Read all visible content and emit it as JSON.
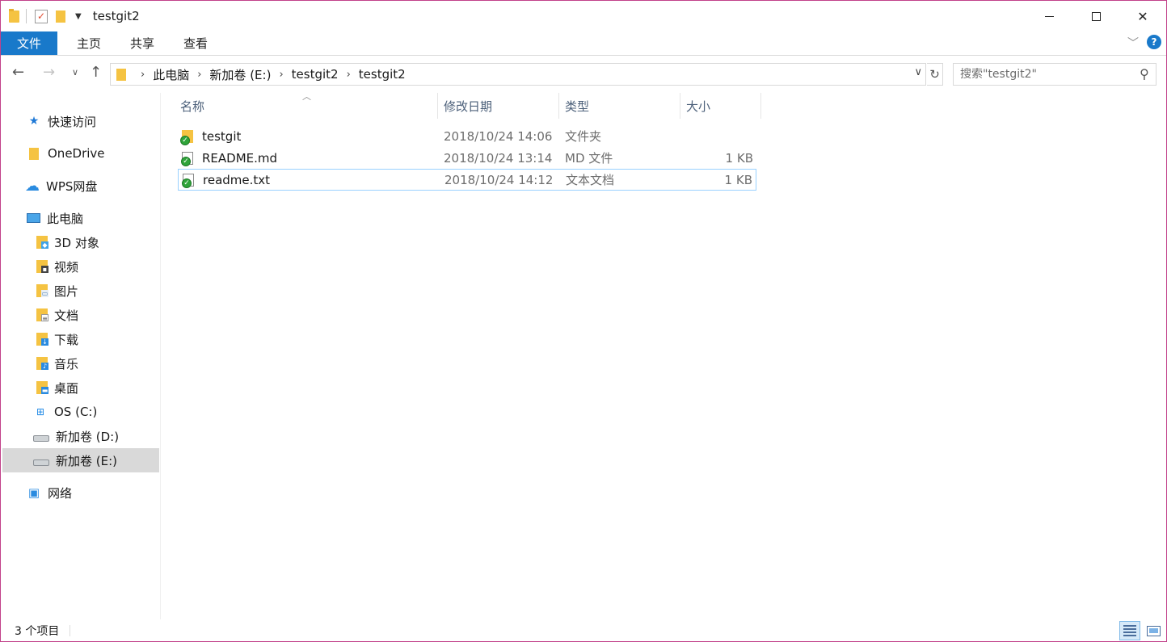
{
  "window": {
    "title": "testgit2"
  },
  "ribbon": {
    "tabs": [
      "文件",
      "主页",
      "共享",
      "查看"
    ]
  },
  "address": {
    "crumbs": [
      "此电脑",
      "新加卷 (E:)",
      "testgit2",
      "testgit2"
    ]
  },
  "search": {
    "placeholder": "搜索\"testgit2\""
  },
  "sidebar": {
    "items": [
      {
        "label": "快速访问",
        "icon": "star-icon"
      },
      {
        "label": "OneDrive",
        "icon": "folder-icon"
      },
      {
        "label": "WPS网盘",
        "icon": "cloud-icon"
      },
      {
        "label": "此电脑",
        "icon": "computer-icon"
      },
      {
        "label": "3D 对象",
        "icon": "3d-objects-icon"
      },
      {
        "label": "视频",
        "icon": "video-icon"
      },
      {
        "label": "图片",
        "icon": "pictures-icon"
      },
      {
        "label": "文档",
        "icon": "documents-icon"
      },
      {
        "label": "下载",
        "icon": "download-icon"
      },
      {
        "label": "音乐",
        "icon": "music-icon"
      },
      {
        "label": "桌面",
        "icon": "desktop-icon"
      },
      {
        "label": "OS (C:)",
        "icon": "windows-drive-icon"
      },
      {
        "label": "新加卷 (D:)",
        "icon": "drive-icon"
      },
      {
        "label": "新加卷 (E:)",
        "icon": "drive-icon",
        "selected": true
      },
      {
        "label": "网络",
        "icon": "network-icon"
      }
    ]
  },
  "columns": {
    "name": "名称",
    "date": "修改日期",
    "type": "类型",
    "size": "大小"
  },
  "files": [
    {
      "name": "testgit",
      "date": "2018/10/24 14:06",
      "type": "文件夹",
      "size": "",
      "icon": "folder-icon",
      "status": "git-synced-badge"
    },
    {
      "name": "README.md",
      "date": "2018/10/24 13:14",
      "type": "MD 文件",
      "size": "1 KB",
      "icon": "file-icon",
      "status": "git-synced-badge"
    },
    {
      "name": "readme.txt",
      "date": "2018/10/24 14:12",
      "type": "文本文档",
      "size": "1 KB",
      "icon": "text-file-icon",
      "status": "git-synced-badge",
      "selected": true
    }
  ],
  "statusbar": {
    "count": "3 个项目"
  },
  "colors": {
    "accent": "#1979ca",
    "selection_border": "#99d1ff",
    "selected_nav": "#d9d9d9",
    "header_text": "#4c607a"
  }
}
